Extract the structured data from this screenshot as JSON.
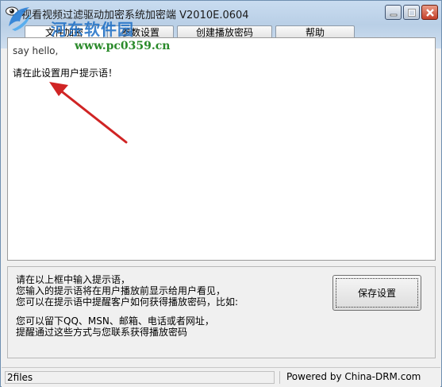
{
  "window": {
    "title": "视看视频过滤驱动加密系统加密端 V2010E.0604"
  },
  "tabs": [
    {
      "label": "文件加密"
    },
    {
      "label": "参数设置"
    },
    {
      "label": "创建播放密码"
    },
    {
      "label": "帮助"
    }
  ],
  "editor": {
    "line1": "say hello,",
    "line2": "请在此设置用户提示语！"
  },
  "watermark": {
    "text": "河东软件园",
    "url": "www.pc0359.cn"
  },
  "hints": {
    "line1": "请在以上框中输入提示语，",
    "line2": "您输入的提示语将在用户播放前显示给用户看见，",
    "line3": "您可以在提示语中提醒客户如何获得播放密码，比如:",
    "line4": "您可以留下QQ、MSN、邮箱、电话或者网址，",
    "line5": "提醒通过这些方式与您联系获得播放密码"
  },
  "buttons": {
    "save": "保存设置"
  },
  "status": {
    "left": "2files",
    "right": "Powered by China-DRM.com"
  },
  "colors": {
    "arrow": "#d02424",
    "watermark_blue": "#1d6fc6",
    "watermark_green": "#2a8a2a"
  }
}
